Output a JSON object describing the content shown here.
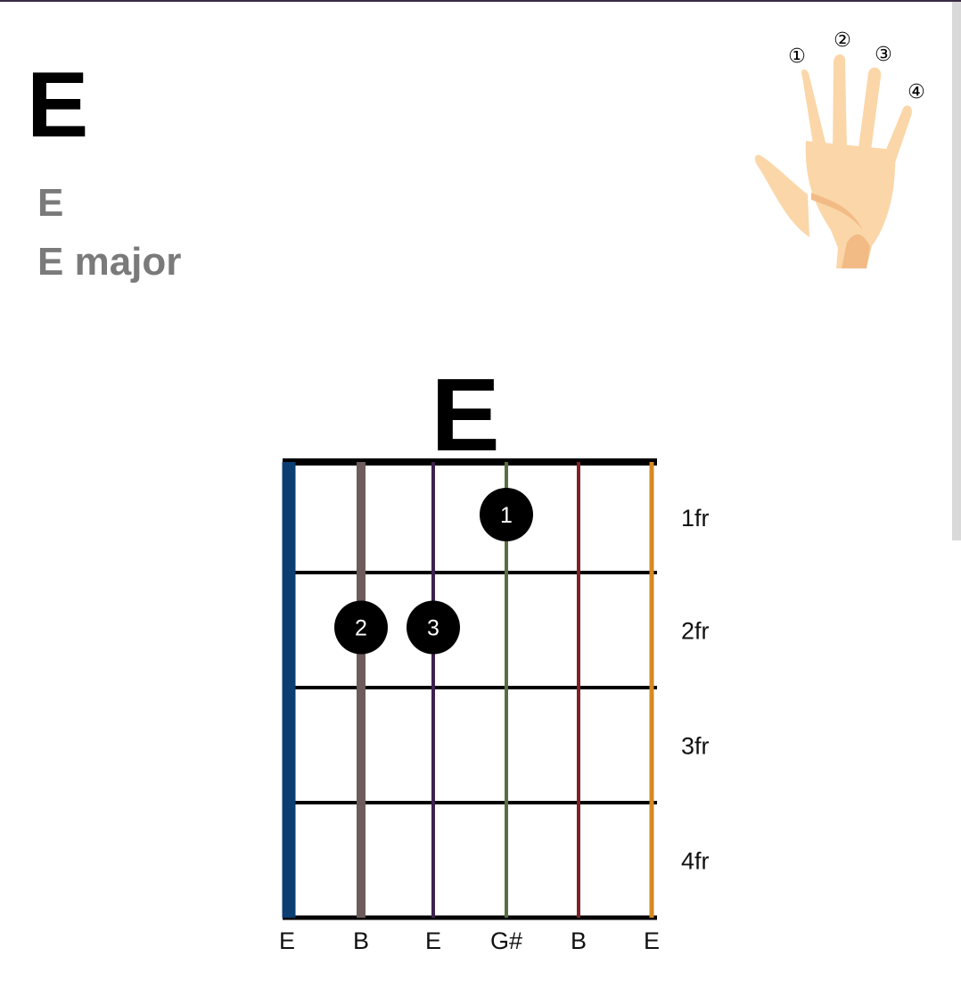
{
  "header": {
    "title": "E",
    "names": [
      "E",
      "E major"
    ]
  },
  "hand_legend": {
    "finger_numbers": [
      "①",
      "②",
      "③",
      "④"
    ],
    "skin_color": "#fbd6a8",
    "skin_shadow_color": "#f2bb85"
  },
  "chart_data": {
    "type": "chord_diagram",
    "chord_name": "E",
    "fret_labels": [
      "1fr",
      "2fr",
      "3fr",
      "4fr"
    ],
    "strings": [
      {
        "note": "E",
        "color": "#0c3e73"
      },
      {
        "note": "B",
        "color": "#6e5b5b"
      },
      {
        "note": "E",
        "color": "#3d2150"
      },
      {
        "note": "G#",
        "color": "#587040"
      },
      {
        "note": "B",
        "color": "#7f2226"
      },
      {
        "note": "E",
        "color": "#d58a24"
      }
    ],
    "fingers": [
      {
        "string": 4,
        "fret": 1,
        "finger": "1"
      },
      {
        "string": 2,
        "fret": 2,
        "finger": "2"
      },
      {
        "string": 3,
        "fret": 2,
        "finger": "3"
      }
    ]
  }
}
